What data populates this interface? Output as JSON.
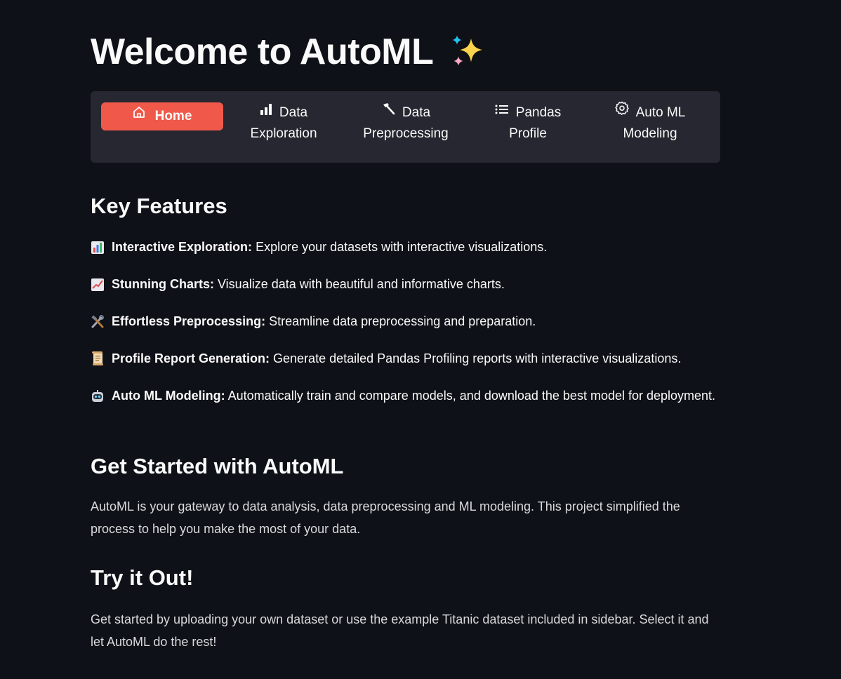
{
  "page": {
    "title": "Welcome to AutoML"
  },
  "nav": {
    "items": [
      {
        "label": "Home",
        "icon": "home-icon",
        "active": true
      },
      {
        "label_line1": "Data",
        "label_line2": "Exploration",
        "icon": "bar-chart-icon"
      },
      {
        "label_line1": "Data",
        "label_line2": "Preprocessing",
        "icon": "hammer-icon"
      },
      {
        "label_line1": "Pandas",
        "label_line2": "Profile",
        "icon": "list-icon"
      },
      {
        "label_line1": "Auto ML",
        "label_line2": "Modeling",
        "icon": "gear-icon"
      }
    ],
    "colors": {
      "active": "#f0594a",
      "bar": "#262730"
    }
  },
  "key_features": {
    "heading": "Key Features",
    "items": [
      {
        "emoji": "bar-chart-emoji",
        "title": "Interactive Exploration:",
        "text": " Explore your datasets with interactive visualizations."
      },
      {
        "emoji": "chart-increasing-emoji",
        "title": "Stunning Charts:",
        "text": " Visualize data with beautiful and informative charts."
      },
      {
        "emoji": "hammer-and-wrench-emoji",
        "title": "Effortless Preprocessing:",
        "text": " Streamline data preprocessing and preparation."
      },
      {
        "emoji": "scroll-emoji",
        "title": "Profile Report Generation:",
        "text": " Generate detailed Pandas Profiling reports with interactive visualizations."
      },
      {
        "emoji": "robot-emoji",
        "title": "Auto ML Modeling:",
        "text": " Automatically train and compare models, and download the best model for deployment."
      }
    ]
  },
  "get_started": {
    "heading": "Get Started with AutoML",
    "text": "AutoML is your gateway to data analysis, data preprocessing and ML modeling. This project simplified the process to help you make the most of your data."
  },
  "try_it": {
    "heading": "Try it Out!",
    "text": "Get started by uploading your own dataset or use the example Titanic dataset included in sidebar. Select it and let AutoML do the rest!"
  },
  "colors": {
    "background": "#0e1117",
    "text": "#fafafa"
  }
}
